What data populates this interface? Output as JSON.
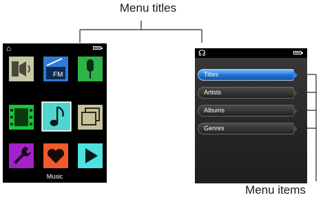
{
  "annotations": {
    "title_label": "Menu titles",
    "items_label": "Menu items"
  },
  "main_screen": {
    "caption": "Music",
    "icons": [
      "speaker-icon",
      "radio-icon",
      "microphone-icon",
      "film-icon",
      "music-note-icon",
      "photos-icon",
      "wrench-icon",
      "heart-icon",
      "play-icon"
    ]
  },
  "music_screen": {
    "items": [
      "Titles",
      "Artists",
      "Albums",
      "Genres"
    ],
    "selected": "Titles"
  },
  "colors": {
    "selected_blue": "#2f86e6",
    "screen_bg": "#000000"
  }
}
